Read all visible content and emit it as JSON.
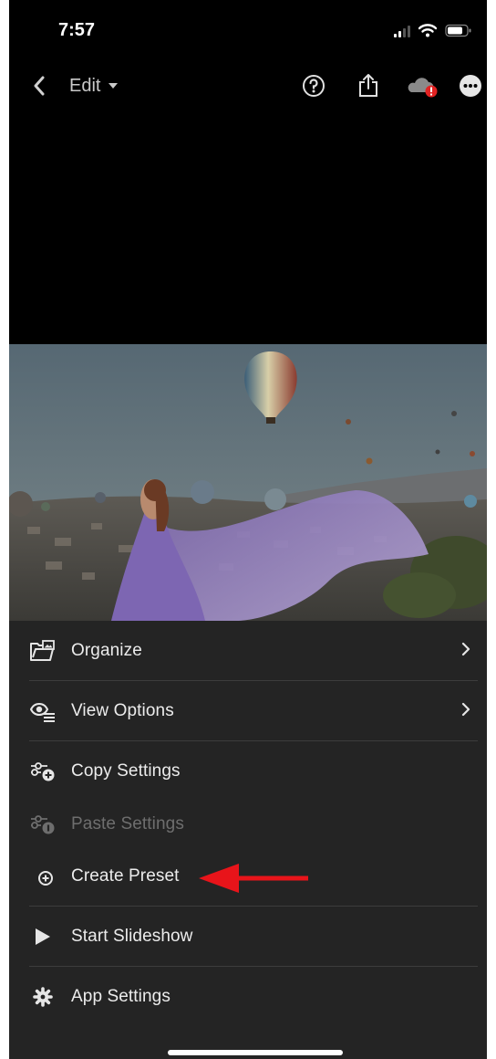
{
  "status_bar": {
    "time": "7:57"
  },
  "nav": {
    "edit_label": "Edit"
  },
  "menu": {
    "organize": "Organize",
    "view_options": "View Options",
    "copy_settings": "Copy Settings",
    "paste_settings": "Paste Settings",
    "create_preset": "Create Preset",
    "start_slideshow": "Start Slideshow",
    "app_settings": "App Settings"
  },
  "icons": {
    "nav": [
      "back-chevron-icon",
      "help-icon",
      "share-icon",
      "cloud-sync-error-icon",
      "more-icon"
    ],
    "menu": [
      "organize-icon",
      "view-options-icon",
      "copy-settings-icon",
      "paste-settings-icon",
      "create-preset-icon",
      "play-icon",
      "gear-icon"
    ]
  },
  "colors": {
    "background": "#000000",
    "sheet": "#242424",
    "text": "#ececec",
    "disabled_text": "#6e6e6e",
    "error_badge": "#e22222",
    "annotation_arrow": "#e8141a"
  }
}
